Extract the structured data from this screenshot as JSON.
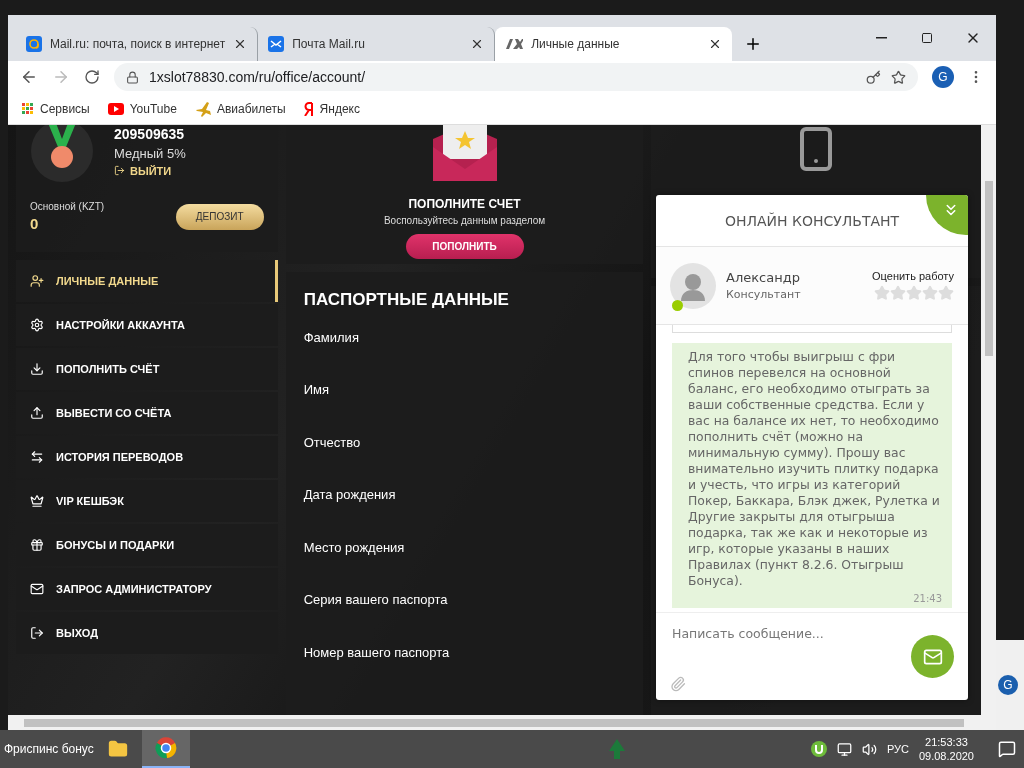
{
  "browser": {
    "tabs": [
      {
        "title": "Mail.ru: почта, поиск в интернет",
        "selected": false
      },
      {
        "title": "Почта Mail.ru",
        "selected": false
      },
      {
        "title": "Личные данные",
        "selected": true
      }
    ],
    "address": "1xslot78830.com/ru/office/account/",
    "profile": "G",
    "bookmarks": [
      "Сервисы",
      "YouTube",
      "Авиабилеты",
      "Яндекс"
    ]
  },
  "account": {
    "id": "209509635",
    "level": "Медный 5%",
    "logout": "ВЫЙТИ",
    "balance_label": "Основной (KZT)",
    "balance": "0",
    "deposit": "ДЕПОЗИТ"
  },
  "menu": [
    {
      "label": "ЛИЧНЫЕ ДАННЫЕ",
      "selected": true
    },
    {
      "label": "НАСТРОЙКИ АККАУНТА",
      "selected": false
    },
    {
      "label": "ПОПОЛНИТЬ СЧЁТ",
      "selected": false
    },
    {
      "label": "ВЫВЕСТИ СО СЧЁТА",
      "selected": false
    },
    {
      "label": "ИСТОРИЯ ПЕРЕВОДОВ",
      "selected": false
    },
    {
      "label": "VIP КЕШБЭК",
      "selected": false
    },
    {
      "label": "БОНУСЫ И ПОДАРКИ",
      "selected": false
    },
    {
      "label": "ЗАПРОС АДМИНИСТРАТОРУ",
      "selected": false
    },
    {
      "label": "ВЫХОД",
      "selected": false
    }
  ],
  "promo": {
    "title": "ПОПОЛНИТЕ СЧЕТ",
    "subtitle": "Воспользуйтесь данным разделом",
    "button": "ПОПОЛНИТЬ"
  },
  "passport": {
    "title": "ПАСПОРТНЫЕ ДАННЫЕ",
    "fields": [
      "Фамилия",
      "Имя",
      "Отчество",
      "Дата рождения",
      "Место рождения",
      "Серия вашего паспорта",
      "Номер вашего паспорта"
    ]
  },
  "chat": {
    "title": "ОНЛАЙН КОНСУЛЬТАНТ",
    "agent": {
      "name": "Александр",
      "role": "Консультант",
      "online": true
    },
    "rate_label": "Оценить работу",
    "stars": 0,
    "message": {
      "text": "Для того чтобы выигрыш с фри спинов перевелся на основной баланс, его необходимо отыграть за ваши собственные средства. Если у вас на балансе их нет, то необходимо пополнить счёт (можно на минимальную сумму). Прошу вас внимательно изучить плитку подарка и учесть, что игры из категорий Покер, Баккара, Блэк джек, Рулетка и Другие закрыты для отыгрыша подарка, так же как и некоторые из игр, которые указаны в наших Правилах (пункт 8.2.6. Отыгрыш Бонуса).",
      "time": "21:43"
    },
    "placeholder": "Написать сообщение..."
  },
  "background_window": {
    "avatar": "G"
  },
  "taskbar": {
    "desktop_label": "Фриспинс бонус",
    "language": "РУС",
    "time": "21:53:33",
    "date": "09.08.2020"
  }
}
